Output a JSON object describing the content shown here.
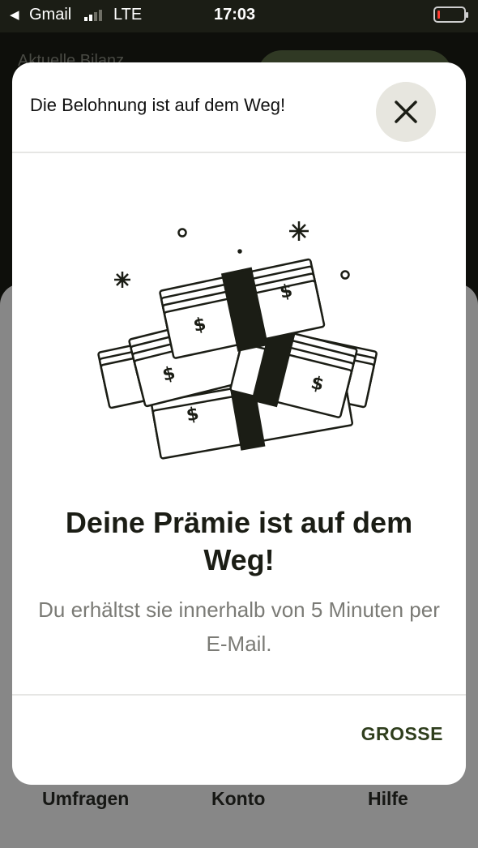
{
  "status_bar": {
    "back_app": "Gmail",
    "network": "LTE",
    "time": "17:03",
    "signal_bars_filled": 2,
    "signal_bars_total": 4,
    "battery_level_fraction": 0.1,
    "battery_color": "#ff3b30"
  },
  "background": {
    "balance_label": "Aktuelle Bilanz",
    "tabs": [
      {
        "label": "Umfragen"
      },
      {
        "label": "Konto"
      },
      {
        "label": "Hilfe"
      }
    ]
  },
  "modal": {
    "title": "Die Belohnung ist auf dem Weg!",
    "close_icon": "close-icon",
    "illustration_icon": "money-stacks-illustration",
    "headline": "Deine Prämie ist auf dem Weg!",
    "subtext": "Du erhältst sie innerhalb von 5 Minuten per E-Mail.",
    "action_label": "GROSSE"
  },
  "colors": {
    "dark_bg": "#1b1d15",
    "accent_green": "#2f3e1d",
    "pill_green": "#5b6c45",
    "close_bg": "#e7e6df"
  }
}
